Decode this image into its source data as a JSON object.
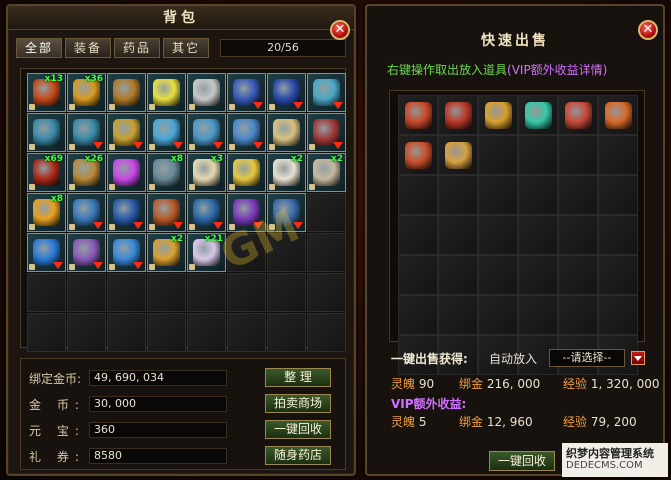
{
  "backpack": {
    "title": "背包",
    "tabs": [
      "全部",
      "装备",
      "药品",
      "其它"
    ],
    "capacity": "20/56",
    "items": [
      {
        "color": "#c44a1a",
        "count": "x13",
        "arrow": false,
        "lock": true
      },
      {
        "color": "#d89a20",
        "count": "x36",
        "arrow": false,
        "lock": true
      },
      {
        "color": "#b07a2a",
        "count": "",
        "arrow": false,
        "lock": true
      },
      {
        "color": "#e8e040",
        "count": "",
        "arrow": false,
        "lock": true
      },
      {
        "color": "#c8c8c8",
        "count": "",
        "arrow": false,
        "lock": true
      },
      {
        "color": "#3a5ab8",
        "count": "",
        "arrow": true,
        "lock": true
      },
      {
        "color": "#2a4aa8",
        "count": "",
        "arrow": true,
        "lock": true
      },
      {
        "color": "#4aa8c8",
        "count": "",
        "arrow": true,
        "lock": false
      },
      {
        "color": "#3a8aa8",
        "count": "",
        "arrow": false,
        "lock": true
      },
      {
        "color": "#3a8aa8",
        "count": "",
        "arrow": true,
        "lock": true
      },
      {
        "color": "#c8a030",
        "count": "",
        "arrow": true,
        "lock": true
      },
      {
        "color": "#4aa8d8",
        "count": "",
        "arrow": true,
        "lock": true
      },
      {
        "color": "#4a98c8",
        "count": "",
        "arrow": true,
        "lock": true
      },
      {
        "color": "#4a88c8",
        "count": "",
        "arrow": true,
        "lock": true
      },
      {
        "color": "#d8c080",
        "count": "",
        "arrow": false,
        "lock": true
      },
      {
        "color": "#a03a3a",
        "count": "",
        "arrow": true,
        "lock": true
      },
      {
        "color": "#a82a1a",
        "count": "x69",
        "arrow": false,
        "lock": true
      },
      {
        "color": "#b88a3a",
        "count": "x26",
        "arrow": false,
        "lock": true
      },
      {
        "color": "#c848e8",
        "count": "",
        "arrow": false,
        "lock": true
      },
      {
        "color": "#6a8a98",
        "count": "x8",
        "arrow": false,
        "lock": true
      },
      {
        "color": "#e8d8b0",
        "count": "x3",
        "arrow": false,
        "lock": true
      },
      {
        "color": "#e8c840",
        "count": "",
        "arrow": false,
        "lock": true
      },
      {
        "color": "#e8e0d0",
        "count": "x2",
        "arrow": false,
        "lock": true
      },
      {
        "color": "#c8b8a0",
        "count": "x2",
        "arrow": false,
        "lock": true
      },
      {
        "color": "#e8a020",
        "count": "x8",
        "arrow": false,
        "lock": true
      },
      {
        "color": "#3a7ab8",
        "count": "",
        "arrow": true,
        "lock": true
      },
      {
        "color": "#2a5aa8",
        "count": "",
        "arrow": true,
        "lock": true
      },
      {
        "color": "#b85a2a",
        "count": "",
        "arrow": true,
        "lock": true
      },
      {
        "color": "#2a6aa8",
        "count": "",
        "arrow": true,
        "lock": true
      },
      {
        "color": "#7a3ab8",
        "count": "",
        "arrow": true,
        "lock": true
      },
      {
        "color": "#3a6aa8",
        "count": "",
        "arrow": true,
        "lock": true
      },
      null,
      {
        "color": "#2a7ad8",
        "count": "",
        "arrow": true,
        "lock": true
      },
      {
        "color": "#8a5ab8",
        "count": "",
        "arrow": true,
        "lock": true
      },
      {
        "color": "#3a8ad8",
        "count": "",
        "arrow": true,
        "lock": true
      },
      {
        "color": "#d8a030",
        "count": "x2",
        "arrow": false,
        "lock": true
      },
      {
        "color": "#d8c8e8",
        "count": "x21",
        "arrow": false,
        "lock": true
      },
      null,
      null,
      null,
      null,
      null,
      null,
      null,
      null,
      null,
      null,
      null,
      null,
      null,
      null,
      null,
      null,
      null,
      null,
      null
    ],
    "info": [
      {
        "label": "绑定金币:",
        "value": "49, 690, 034",
        "tight": true,
        "button": "整 理"
      },
      {
        "label": "金 币:",
        "value": "30, 000",
        "tight": false,
        "button": "拍卖商场"
      },
      {
        "label": "元 宝:",
        "value": "360",
        "tight": false,
        "button": "一键回收"
      },
      {
        "label": "礼 券:",
        "value": "8580",
        "tight": false,
        "button": "随身药店"
      }
    ]
  },
  "quick_sell": {
    "title": "快速出售",
    "hint_prefix": "右键操作取出放入道具",
    "hint_vip": "(VIP额外收益详情)",
    "items": [
      {
        "color": "#c84a2a"
      },
      {
        "color": "#b83a2a"
      },
      {
        "color": "#d8a030"
      },
      {
        "color": "#38c8a8"
      },
      {
        "color": "#c84a3a"
      },
      {
        "color": "#d86a2a"
      },
      {
        "color": "#c8502a"
      },
      {
        "color": "#d8a040"
      },
      null,
      null,
      null,
      null,
      null,
      null,
      null,
      null,
      null,
      null,
      null,
      null,
      null,
      null,
      null,
      null,
      null,
      null,
      null,
      null,
      null,
      null,
      null,
      null,
      null,
      null,
      null,
      null,
      null,
      null,
      null,
      null,
      null,
      null
    ],
    "sell_label": "一键出售获得:",
    "auto_label": "自动放入",
    "select_value": "--请选择--",
    "gain": {
      "spirit_label": "灵魄",
      "spirit_value": "90",
      "gold_label": "绑金",
      "gold_value": "216, 000",
      "exp_label": "经验",
      "exp_value": "1, 320, 000"
    },
    "vip_title": "VIP额外收益:",
    "vip_gain": {
      "spirit_label": "灵魄",
      "spirit_value": "5",
      "gold_label": "绑金",
      "gold_value": "12, 960",
      "exp_label": "经验",
      "exp_value": "79, 200"
    },
    "recycle_button": "一键回收"
  },
  "watermark": "GM",
  "footer": {
    "line1": "织梦内容管理系统",
    "line2": "DEDECMS.COM"
  },
  "close_glyph": "✕"
}
